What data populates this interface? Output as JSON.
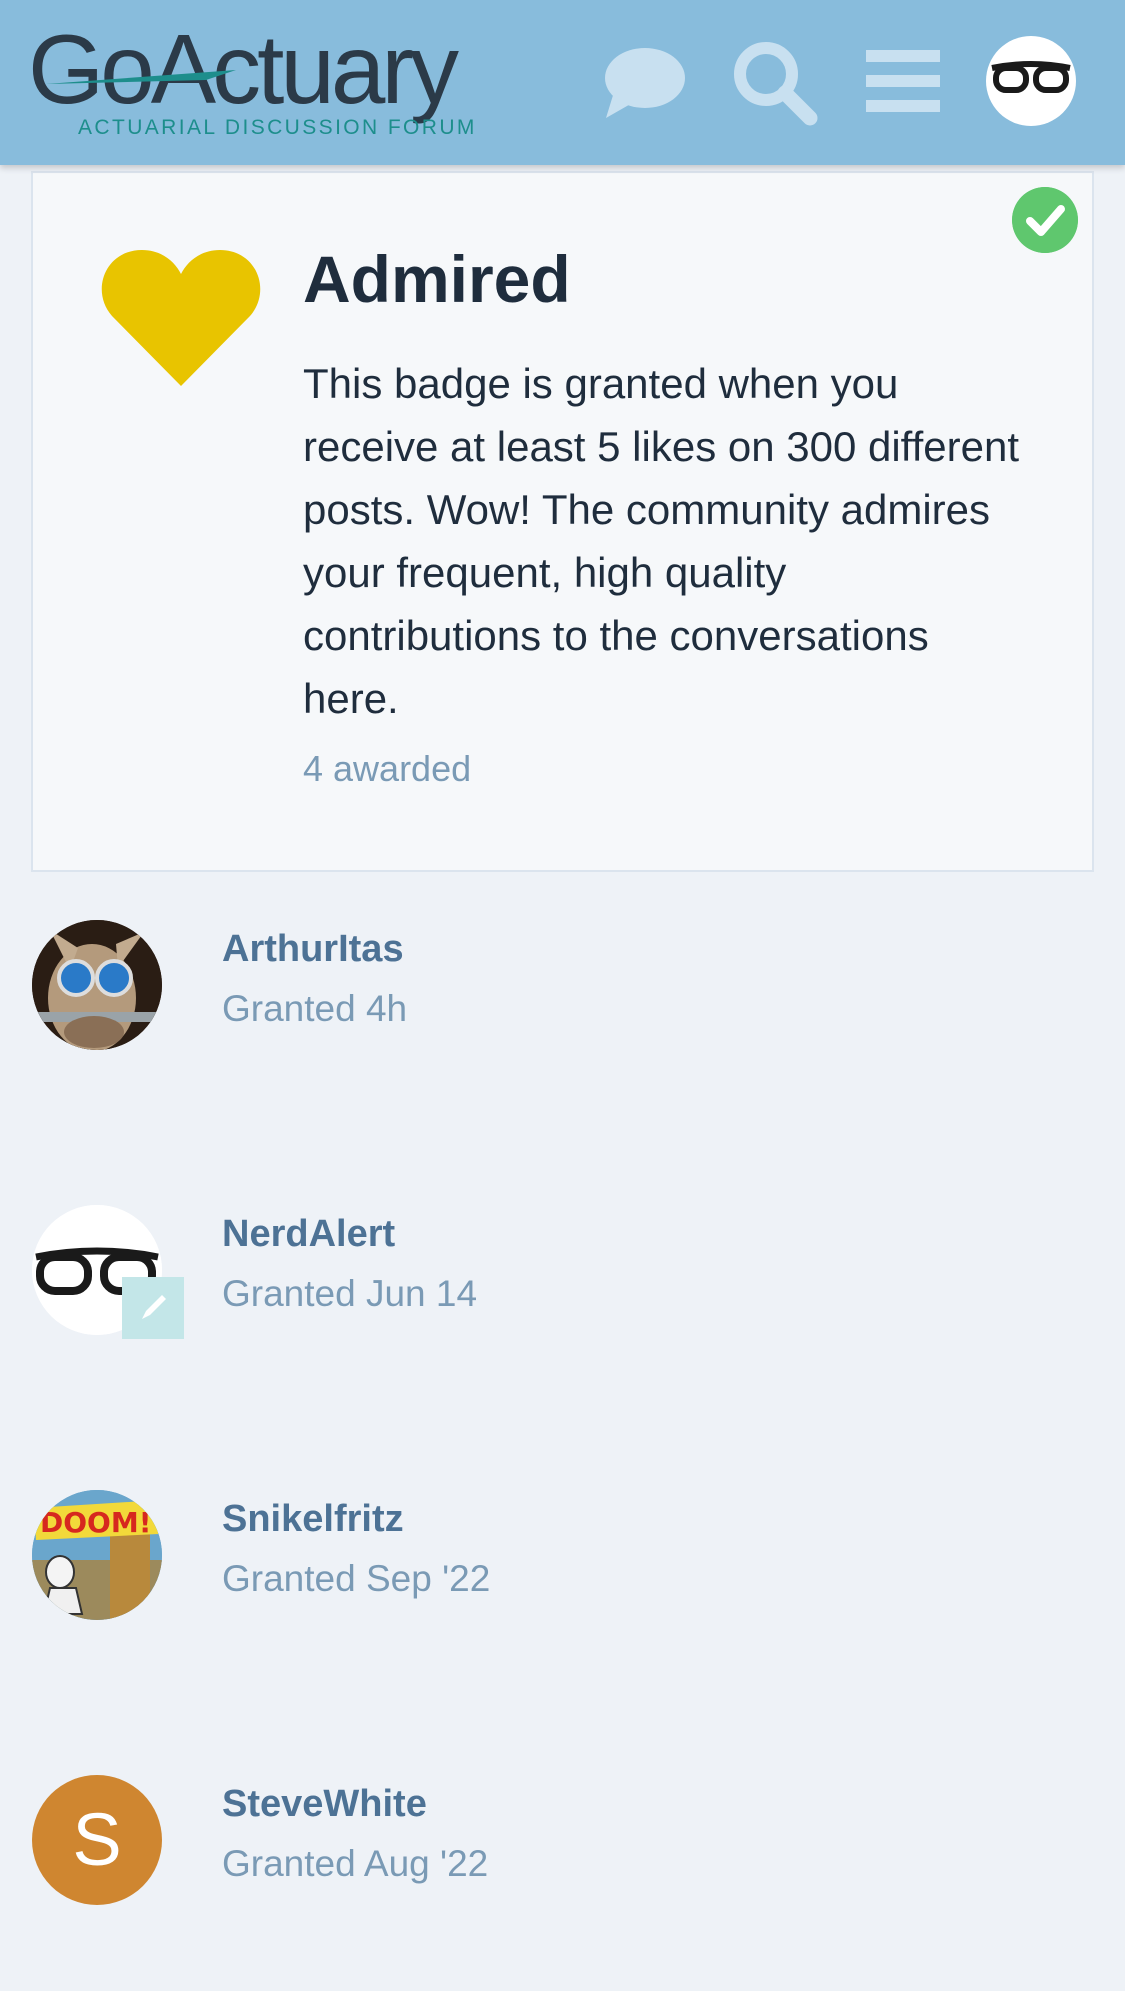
{
  "header": {
    "logo_word": "GoActuary",
    "logo_tagline": "ACTUARIAL DISCUSSION FORUM",
    "brand_color": "#88bcdc",
    "icons": [
      "chat-icon",
      "search-icon",
      "hamburger-menu-icon",
      "user-avatar"
    ]
  },
  "badge": {
    "title": "Admired",
    "description": "This badge is granted when you receive at least 5 likes on 300 different posts. Wow! The community admires your frequent, high quality contributions to the conversations here.",
    "awarded": "4 awarded",
    "icon": "heart-icon",
    "icon_color": "#e8c400",
    "owned": true
  },
  "users": [
    {
      "name": "ArthurItas",
      "granted": "Granted 4h",
      "avatar": "donkey-sunglasses-avatar"
    },
    {
      "name": "NerdAlert",
      "granted": "Granted Jun 14",
      "avatar": "glasses-avatar",
      "moderator": true
    },
    {
      "name": "Snikelfritz",
      "granted": "Granted Sep '22",
      "avatar": "doom-comic-avatar"
    },
    {
      "name": "SteveWhite",
      "granted": "Granted Aug '22",
      "avatar_letter": "S",
      "avatar_color": "#cf8630"
    }
  ]
}
